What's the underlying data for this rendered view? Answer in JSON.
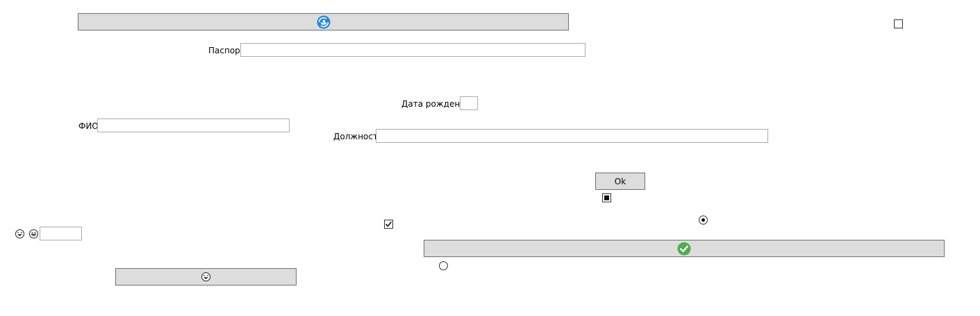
{
  "form": {
    "passport_label": "Паспорт",
    "passport_value": "",
    "birthdate_label": "Дата рождения",
    "birthdate_value": "",
    "fio_label": "ФИО",
    "fio_value": "",
    "position_label": "Должность",
    "position_value": "",
    "small_field_value": ""
  },
  "buttons": {
    "ok_label": "Ok"
  },
  "icons": {
    "top_button_icon": "ship-refresh-icon",
    "wide_button_icon": "checkmark-circle-icon",
    "bottom_button_icon": "laughing-face-icon",
    "emoji_1": "laughing-face-icon",
    "emoji_2": "grinning-face-icon"
  },
  "colors": {
    "button_bg": "#dddddd",
    "button_border": "#707070",
    "field_border": "#ababab",
    "icon_blue": "#1e88e5",
    "icon_green": "#4caf50"
  }
}
